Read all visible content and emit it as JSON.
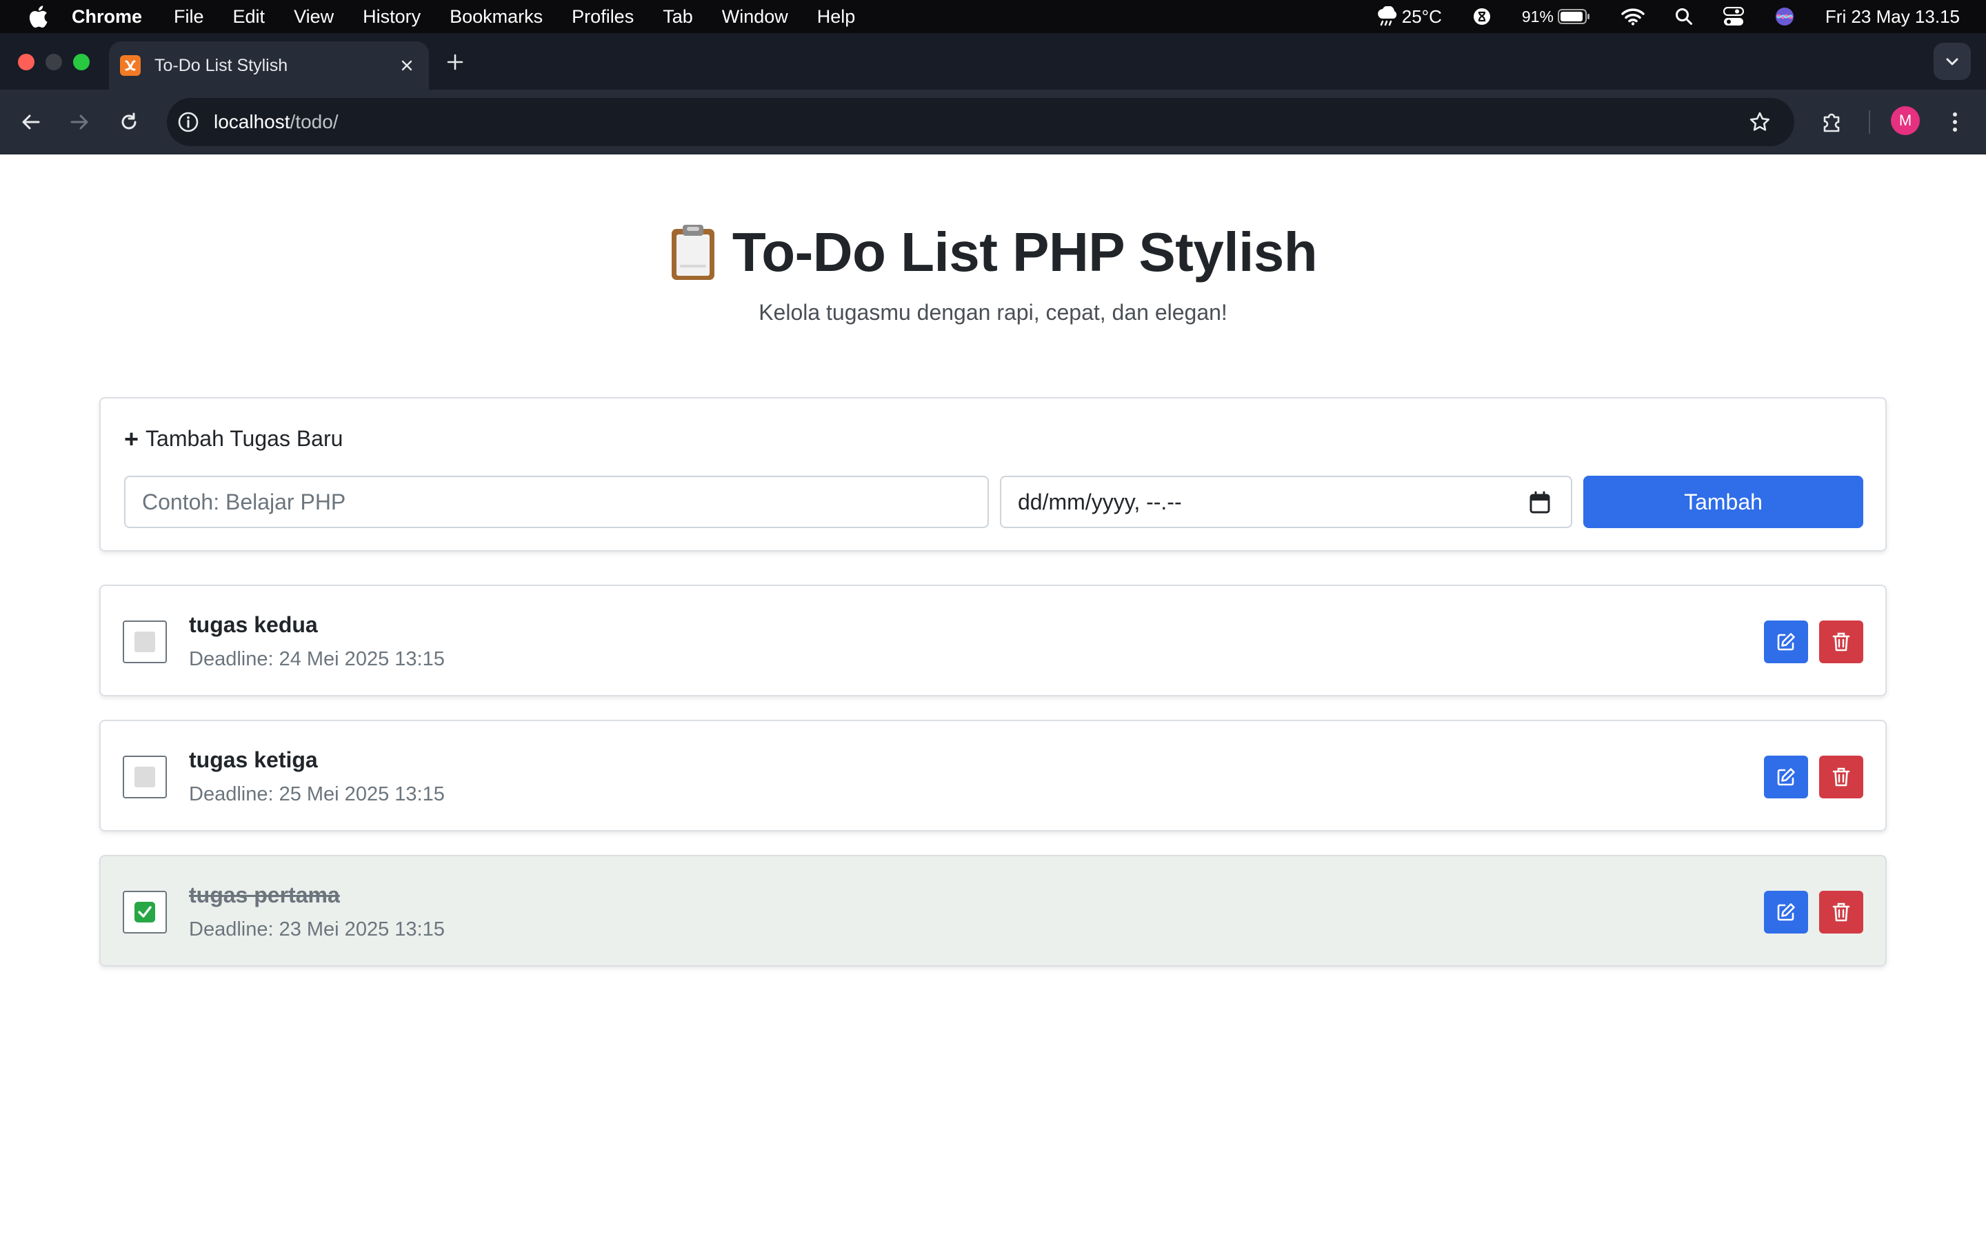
{
  "menubar": {
    "app_name": "Chrome",
    "items": [
      "File",
      "Edit",
      "View",
      "History",
      "Bookmarks",
      "Profiles",
      "Tab",
      "Window",
      "Help"
    ],
    "weather": "25°C",
    "battery": "91%",
    "datetime": "Fri 23 May  13.15"
  },
  "browser": {
    "tab_title": "To-Do List Stylish",
    "url_host": "localhost",
    "url_path": "/todo/",
    "profile_initial": "M"
  },
  "page": {
    "title": "To-Do List PHP Stylish",
    "subtitle": "Kelola tugasmu dengan rapi, cepat, dan elegan!",
    "add_form": {
      "heading": "Tambah Tugas Baru",
      "task_placeholder": "Contoh: Belajar PHP",
      "date_placeholder": "dd/mm/yyyy, --.--",
      "submit_label": "Tambah"
    },
    "tasks": [
      {
        "name": "tugas kedua",
        "deadline": "Deadline: 24 Mei 2025 13:15",
        "done": false
      },
      {
        "name": "tugas ketiga",
        "deadline": "Deadline: 25 Mei 2025 13:15",
        "done": false
      },
      {
        "name": "tugas pertama",
        "deadline": "Deadline: 23 Mei 2025 13:15",
        "done": true
      }
    ]
  },
  "colors": {
    "primary": "#2f6de9",
    "danger": "#d23b43",
    "success": "#27a745",
    "done_row_bg": "#ebf0ec"
  }
}
